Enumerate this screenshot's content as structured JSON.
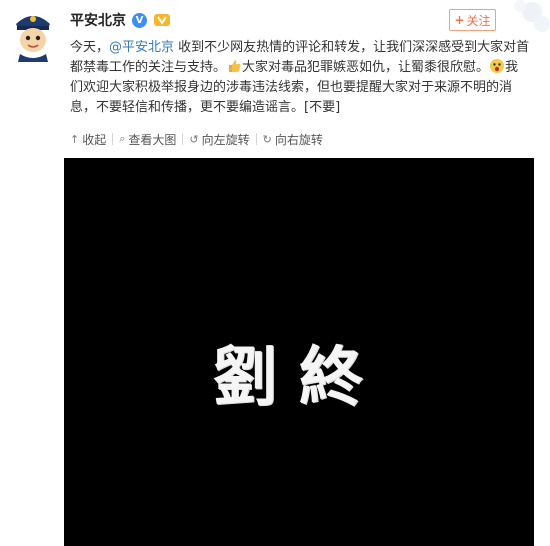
{
  "post": {
    "author": "平安北京",
    "verified_badge": "V",
    "follow_label": "关注",
    "text_part1": "今天，",
    "mention": "@平安北京",
    "text_part2": " 收到不少网友热情的评论和转发，让我们深深感受到大家对首都禁毒工作的关注与支持。",
    "text_part3": "大家对毒品犯罪嫉恶如仇，让蜀黍很欣慰。",
    "text_part4": "我们欢迎大家积极举报身边的涉毒违法线索，但也要提醒大家对于来源不明的消息，不要轻信和传播，更不要编造谣言。[不要]"
  },
  "actions": {
    "collapse": "收起",
    "view_large": "查看大图",
    "rotate_left": "向左旋转",
    "rotate_right": "向右旋转"
  },
  "image": {
    "caption": "劉終"
  },
  "colors": {
    "accent_orange": "#eb7350",
    "link_blue": "#3679b5",
    "verified_blue": "#3b8ff5",
    "photo_bg": "#000000"
  },
  "icons": [
    "police-avatar-icon",
    "verified-icon",
    "medal-icon",
    "thumbs-up-icon",
    "surprised-face-icon",
    "collapse-icon",
    "magnify-icon",
    "rotate-left-icon",
    "rotate-right-icon"
  ]
}
